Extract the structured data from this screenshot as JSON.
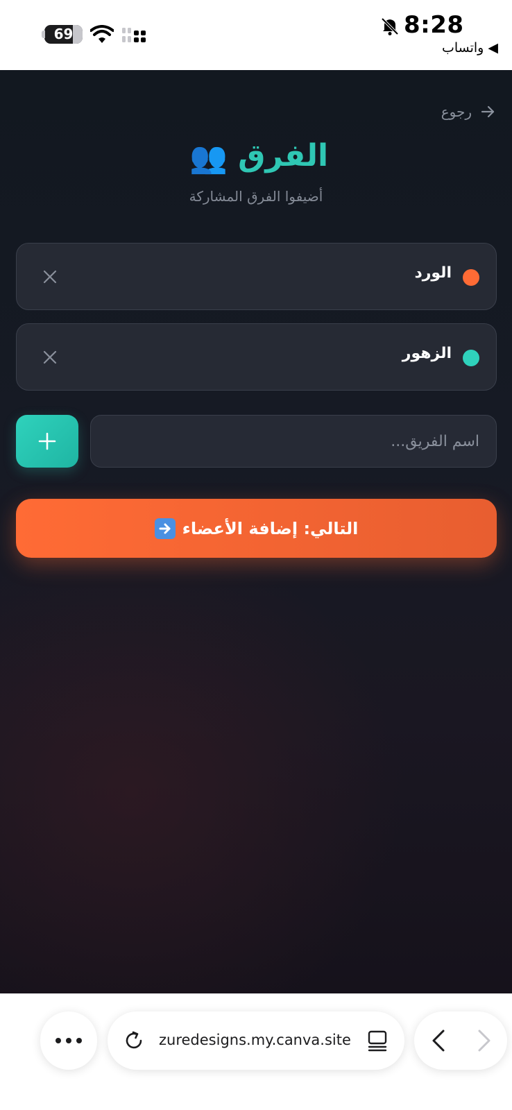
{
  "status_bar": {
    "battery": "69",
    "time": "8:28",
    "back_app": "◀ واتساب"
  },
  "page": {
    "back_label": "رجوع",
    "title": "الفرق",
    "title_emoji": "👥",
    "subtitle": "أضيفوا الفرق المشاركة"
  },
  "teams": [
    {
      "name": "الورد",
      "color": "#ff6b35"
    },
    {
      "name": "الزهور",
      "color": "#2fd2bc"
    }
  ],
  "input": {
    "placeholder": "اسم الفريق...",
    "value": ""
  },
  "next_button": {
    "label": "التالي: إضافة الأعضاء",
    "emoji": "➡"
  },
  "browser": {
    "url": "zuredesigns.my.canva.site"
  },
  "colors": {
    "accent_teal": "#2fc7b4",
    "accent_orange": "#ff6b35"
  }
}
